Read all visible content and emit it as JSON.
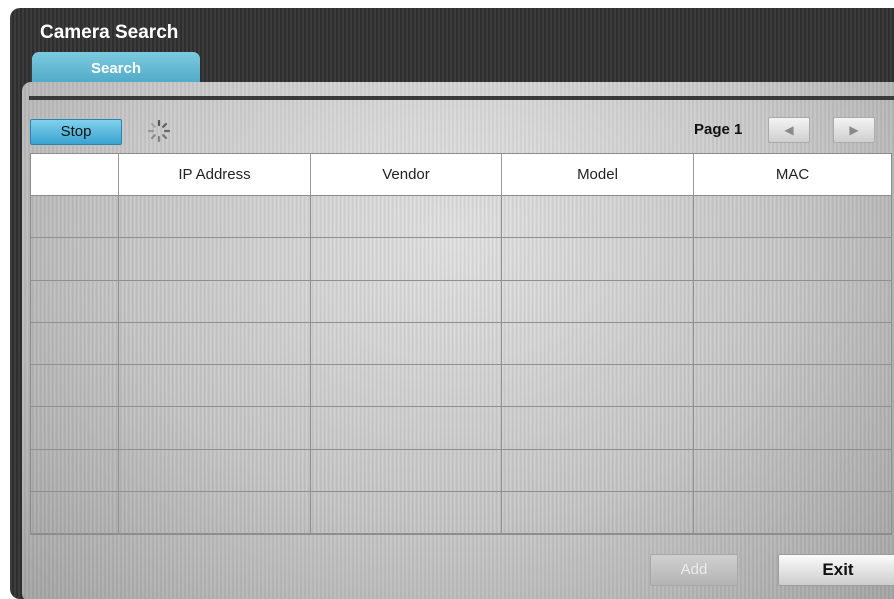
{
  "window": {
    "title": "Camera Search",
    "tabs": [
      {
        "label": "Search",
        "active": true
      }
    ]
  },
  "toolbar": {
    "stop_label": "Stop",
    "loading_icon": "spinner-icon",
    "page_label": "Page 1",
    "prev_icon": "triangle-left-icon",
    "next_icon": "triangle-right-icon"
  },
  "table": {
    "columns": [
      "",
      "IP Address",
      "Vendor",
      "Model",
      "MAC"
    ],
    "rows": [
      [
        "",
        "",
        "",
        "",
        ""
      ],
      [
        "",
        "",
        "",
        "",
        ""
      ],
      [
        "",
        "",
        "",
        "",
        ""
      ],
      [
        "",
        "",
        "",
        "",
        ""
      ],
      [
        "",
        "",
        "",
        "",
        ""
      ],
      [
        "",
        "",
        "",
        "",
        ""
      ],
      [
        "",
        "",
        "",
        "",
        ""
      ],
      [
        "",
        "",
        "",
        "",
        ""
      ]
    ]
  },
  "footer": {
    "add_label": "Add",
    "add_enabled": false,
    "exit_label": "Exit"
  },
  "colors": {
    "accent": "#4aa8d2",
    "frame": "#333333"
  }
}
